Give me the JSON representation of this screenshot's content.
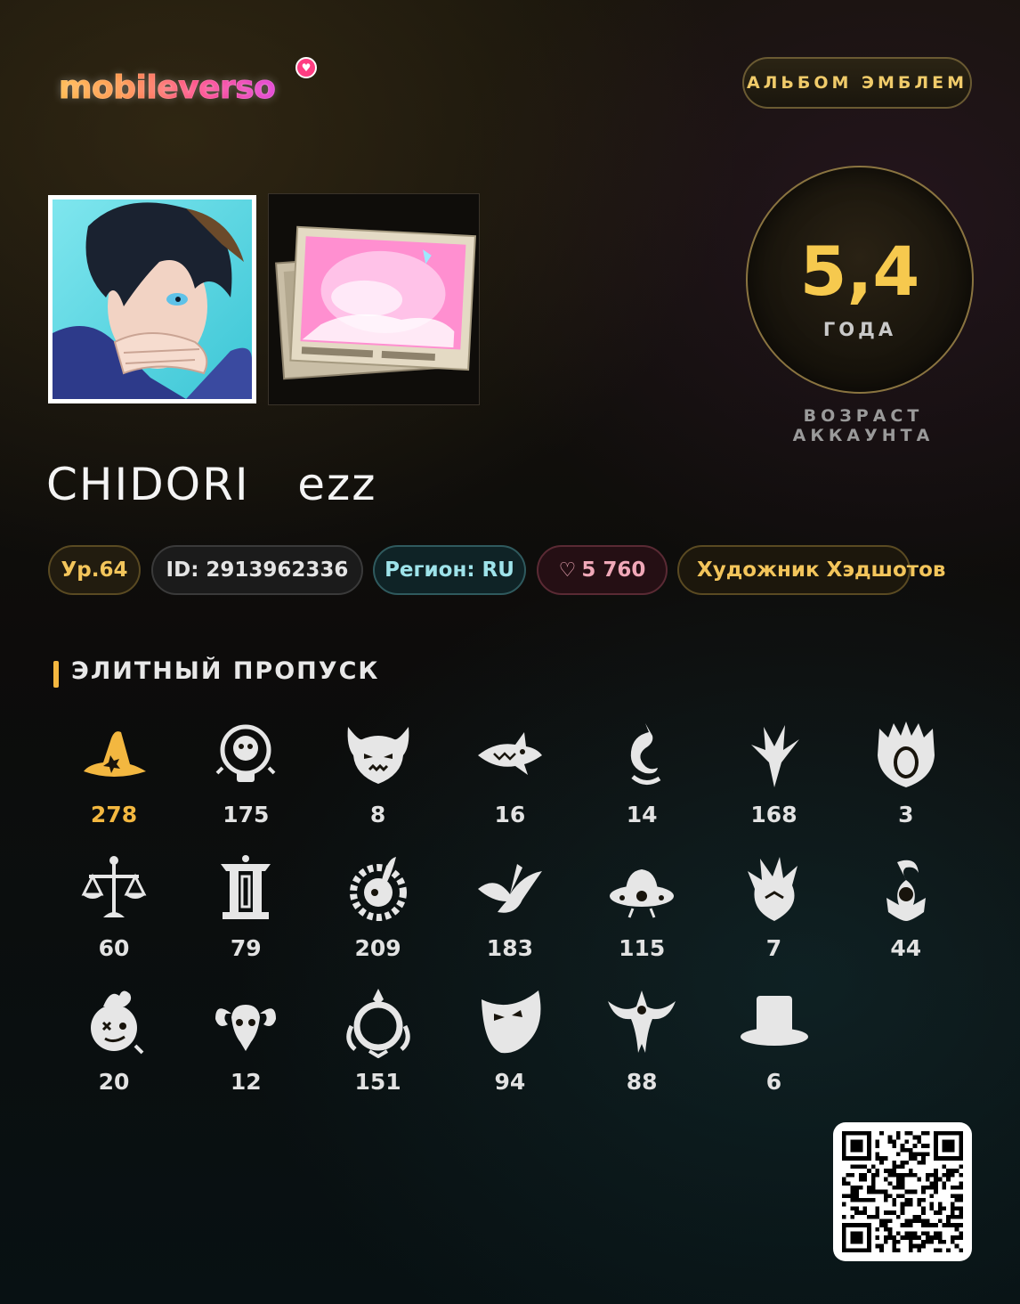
{
  "logo": {
    "text": "mobileverso",
    "heart": "♥"
  },
  "header": {
    "album_button": "АЛЬБОМ ЭМБЛЕМ"
  },
  "account_age": {
    "value": "5,4",
    "unit": "ГОДА",
    "caption": "ВОЗРАСТ АККАУНТА"
  },
  "player": {
    "name": "CHIDORI   ezz",
    "level": "Ур.64",
    "id": "ID: 2913962336",
    "region": "Регион: RU",
    "likes": "5 760",
    "likes_icon": "heart-outline-icon",
    "title": "Художник Хэдшотов"
  },
  "section": {
    "title": "ЭЛИТНЫЙ ПРОПУСК"
  },
  "emblems": [
    {
      "icon": "witch-hat-icon",
      "count": "278",
      "color": "#f3b740"
    },
    {
      "icon": "skull-lightbulb-icon",
      "count": "175"
    },
    {
      "icon": "demon-mask-icon",
      "count": "8"
    },
    {
      "icon": "shark-icon",
      "count": "16"
    },
    {
      "icon": "dragon-coil-icon",
      "count": "14"
    },
    {
      "icon": "blade-crest-icon",
      "count": "168"
    },
    {
      "icon": "ornate-queen-icon",
      "count": "3"
    },
    {
      "icon": "scales-icon",
      "count": "60"
    },
    {
      "icon": "lantern-gate-icon",
      "count": "79"
    },
    {
      "icon": "rabbit-gear-icon",
      "count": "209"
    },
    {
      "icon": "crane-icon",
      "count": "183"
    },
    {
      "icon": "ufo-icon",
      "count": "115"
    },
    {
      "icon": "flame-spikes-icon",
      "count": "7"
    },
    {
      "icon": "scorpion-icon",
      "count": "44"
    },
    {
      "icon": "jester-face-icon",
      "count": "20"
    },
    {
      "icon": "ram-skull-icon",
      "count": "12"
    },
    {
      "icon": "ornate-mirror-icon",
      "count": "151"
    },
    {
      "icon": "theater-mask-icon",
      "count": "94"
    },
    {
      "icon": "bat-wings-icon",
      "count": "88"
    },
    {
      "icon": "top-hat-icon",
      "count": "6"
    }
  ],
  "colors": {
    "gold": "#f3b740",
    "text": "#e2e2e2",
    "accent_teal": "#9ee3ea"
  }
}
